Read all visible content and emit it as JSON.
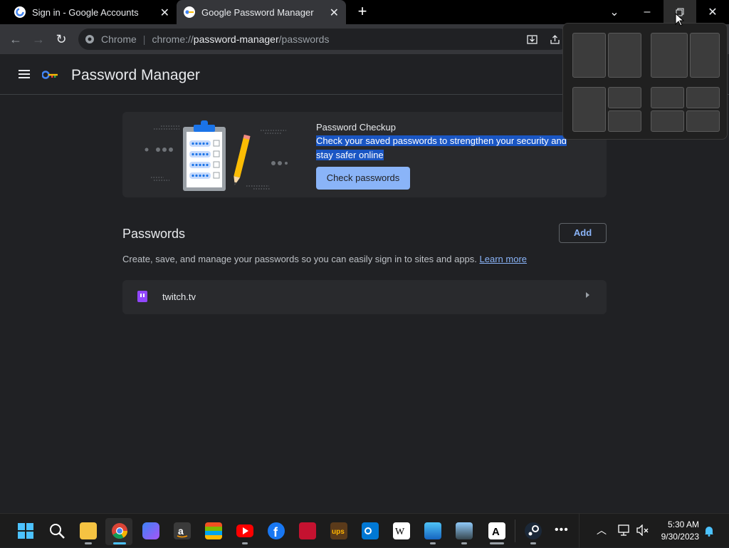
{
  "tabs": [
    {
      "title": "Sign in - Google Accounts"
    },
    {
      "title": "Google Password Manager"
    }
  ],
  "omnibox": {
    "chip": "Chrome",
    "url_prefix": "chrome://",
    "url_host": "password-manager",
    "url_path": "/passwords"
  },
  "header": {
    "title": "Password Manager"
  },
  "checkup": {
    "title": "Password Checkup",
    "description": "Check your saved passwords to strengthen your security and stay safer online",
    "button": "Check passwords"
  },
  "passwords": {
    "heading": "Passwords",
    "add_label": "Add",
    "description": "Create, save, and manage your passwords so you can easily sign in to sites and apps.",
    "learn_more": "Learn more",
    "items": [
      {
        "site": "twitch.tv",
        "icon": "twitch-icon"
      }
    ]
  },
  "taskbar": {
    "time": "5:30 AM",
    "date": "9/30/2023",
    "apps": [
      "start",
      "search",
      "file-explorer",
      "chrome",
      "copilot",
      "amazon",
      "store",
      "youtube",
      "facebook",
      "bank",
      "ups",
      "outlook",
      "wikipedia",
      "photos",
      "gallery",
      "app",
      "steam",
      "more"
    ]
  },
  "colors": {
    "accent": "#8ab4f8",
    "selection": "#1a56c4",
    "twitch": "#9146ff"
  }
}
